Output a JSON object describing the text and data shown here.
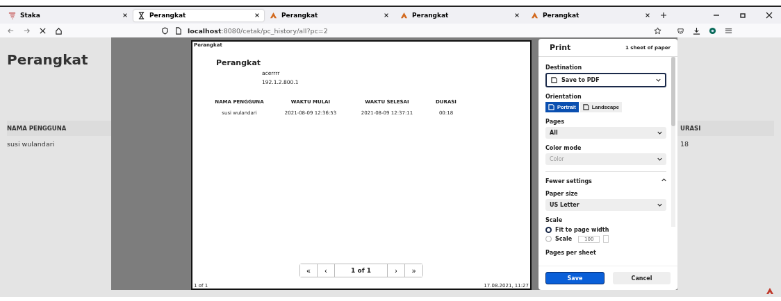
{
  "tabs": [
    {
      "title": "Staka",
      "selected": false
    },
    {
      "title": "Perangkat",
      "selected": true
    },
    {
      "title": "Perangkat",
      "selected": false
    },
    {
      "title": "Perangkat",
      "selected": false
    },
    {
      "title": "Perangkat",
      "selected": false
    }
  ],
  "address": {
    "host": "localhost",
    "path": ":8080/cetak/pc_history/all?pc=2"
  },
  "page": {
    "heading": "Perangkat",
    "columns": [
      "NAMA PENGGUNA",
      "URASI"
    ],
    "row": [
      "susi wulandari",
      "18"
    ]
  },
  "preview": {
    "header_left": "Perangkat",
    "title": "Perangkat",
    "device": "acerrrr",
    "ip": "192.1.2.800.1",
    "columns": [
      "NAMA PENGGUNA",
      "WAKTU MULAI",
      "WAKTU SELESAI",
      "DURASI"
    ],
    "rows": [
      [
        "susi wulandari",
        "2021-08-09 12:36:53",
        "2021-08-09 12:37:11",
        "00:18"
      ]
    ],
    "pager": {
      "first": "«",
      "prev": "‹",
      "label": "1 of 1",
      "next": "›",
      "last": "»"
    },
    "footer_left": "1 of 1",
    "footer_right": "17.08.2021, 11:27"
  },
  "print": {
    "title": "Print",
    "sheets": "1 sheet of paper",
    "destination": {
      "label": "Destination",
      "value": "Save to PDF"
    },
    "orientation": {
      "label": "Orientation",
      "options": [
        {
          "label": "Portrait",
          "selected": true
        },
        {
          "label": "Landscape",
          "selected": false
        }
      ]
    },
    "pages": {
      "label": "Pages",
      "value": "All"
    },
    "color_mode": {
      "label": "Color mode",
      "value": "Color",
      "disabled": true
    },
    "fewer": {
      "label": "Fewer settings",
      "expanded": true
    },
    "paper_size": {
      "label": "Paper size",
      "value": "US Letter"
    },
    "scale": {
      "label": "Scale",
      "options": [
        {
          "label": "Fit to page width",
          "selected": true
        },
        {
          "label": "Scale",
          "selected": false
        }
      ],
      "value": "100"
    },
    "pages_per_sheet": {
      "label": "Pages per sheet"
    },
    "buttons": [
      "Save",
      "Cancel"
    ]
  }
}
